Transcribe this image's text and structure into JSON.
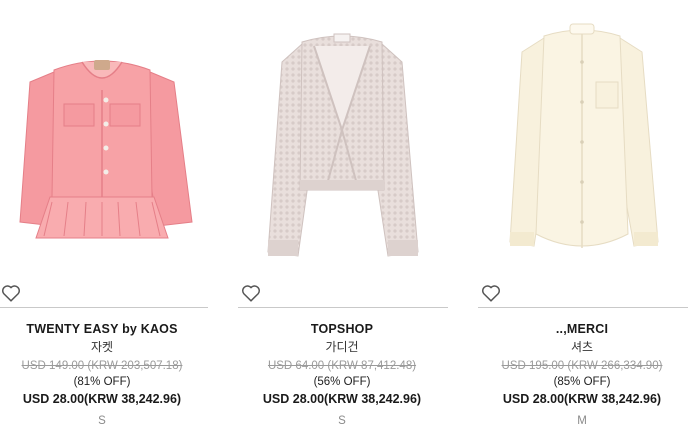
{
  "products": [
    {
      "brand": "TWENTY EASY by KAOS",
      "category": "자켓",
      "original_price": "USD 149.00 (KRW 203,507.18)",
      "discount": "(81% OFF)",
      "price": "USD 28.00(KRW 38,242.96)",
      "size": "S",
      "image_desc": "pink-denim-peplum-jacket",
      "colors": {
        "main": "#f59aa0",
        "shade": "#e57f88",
        "light": "#fbb7b8"
      }
    },
    {
      "brand": "TOPSHOP",
      "category": "가디건",
      "original_price": "USD 64.00 (KRW 87,412.48)",
      "discount": "(56% OFF)",
      "price": "USD 28.00(KRW 38,242.96)",
      "size": "S",
      "image_desc": "light-pink-knit-cardigan",
      "colors": {
        "main": "#e9dfdc",
        "shade": "#cfc2bf",
        "light": "#f3ecea"
      }
    },
    {
      "brand": "..,MERCI",
      "category": "셔츠",
      "original_price": "USD 195.00 (KRW 266,334.90)",
      "discount": "(85% OFF)",
      "price": "USD 28.00(KRW 38,242.96)",
      "size": "M",
      "image_desc": "ivory-silk-shirt",
      "colors": {
        "main": "#f8f1dd",
        "shade": "#e6dcc3",
        "light": "#fdf9ee"
      }
    }
  ],
  "icons": {
    "wishlist": "heart-outline-icon"
  }
}
